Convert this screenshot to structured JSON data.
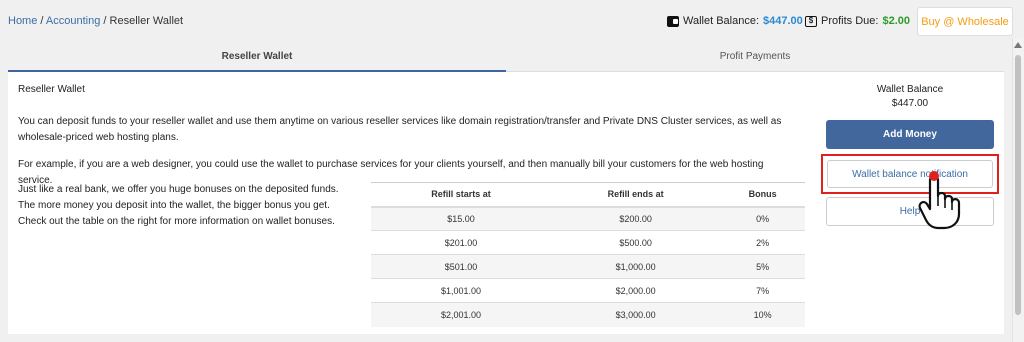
{
  "breadcrumb": {
    "home": "Home",
    "sep1": " / ",
    "accounting": "Accounting",
    "sep2": " / ",
    "current": "Reseller Wallet"
  },
  "header": {
    "wallet_label": "Wallet Balance:",
    "wallet_amount": "$447.00",
    "profits_label": "Profits Due:",
    "profits_amount": "$2.00",
    "buy_label": "Buy @ Wholesale"
  },
  "tabs": [
    {
      "label": "Reseller Wallet",
      "active": true
    },
    {
      "label": "Profit Payments",
      "active": false
    }
  ],
  "main": {
    "title": "Reseller Wallet",
    "paragraph1": "You can deposit funds to your reseller wallet and use them anytime on various reseller services like domain registration/transfer and Private DNS Cluster services, as well as wholesale-priced web hosting plans.",
    "paragraph2": "For example, if you are a web designer, you could use the wallet to purchase services for your clients yourself, and then manually bill your customers for the web hosting service.",
    "paragraph3": "Just like a real bank, we offer you huge bonuses on the deposited funds. The more money you deposit into the wallet, the bigger bonus you get. Check out the table on the right for more information on wallet bonuses."
  },
  "table": {
    "headers": [
      "Refill starts at",
      "Refill ends at",
      "Bonus"
    ],
    "rows": [
      [
        "$15.00",
        "$200.00",
        "0%"
      ],
      [
        "$201.00",
        "$500.00",
        "2%"
      ],
      [
        "$501.00",
        "$1,000.00",
        "5%"
      ],
      [
        "$1,001.00",
        "$2,000.00",
        "7%"
      ],
      [
        "$2,001.00",
        "$3,000.00",
        "10%"
      ]
    ]
  },
  "sidebar": {
    "balance_label": "Wallet Balance",
    "balance_value": "$447.00",
    "add_money": "Add Money",
    "notification": "Wallet balance notification",
    "help": "Help"
  },
  "colors": {
    "accent_blue": "#41679c",
    "link_blue": "#3a6ea5",
    "amount_blue": "#2a8bd0",
    "amount_green": "#2e9a2e",
    "buy_orange": "#f39c12",
    "highlight_red": "#e02020"
  },
  "icons": [
    "wallet-icon",
    "dollar-icon",
    "hand-pointer-icon"
  ]
}
